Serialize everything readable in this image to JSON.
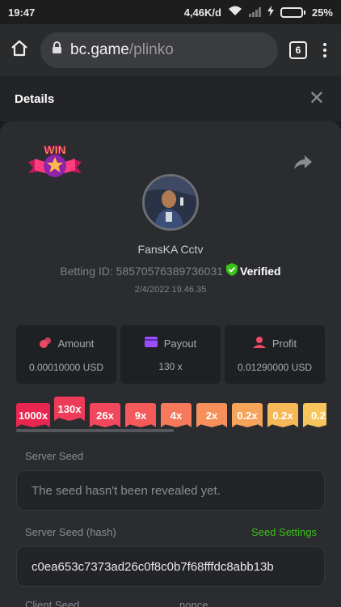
{
  "status_bar": {
    "time": "19:47",
    "speed": "4,46K/d",
    "battery": "25%",
    "battery_level": 0.25
  },
  "browser": {
    "url_host": "bc.game",
    "url_path": "/plinko",
    "tab_count": "6"
  },
  "details": {
    "title": "Details"
  },
  "player": {
    "name": "FansKA Cctv",
    "betting_id": "Betting ID: 58570576389736031",
    "verified_label": "Verified",
    "datetime": "2/4/2022 19.46.35"
  },
  "stats": {
    "amount_label": "Amount",
    "amount_value": "0.00010000 USD",
    "payout_label": "Payout",
    "payout_value": "130 x",
    "profit_label": "Profit",
    "profit_value": "0.01290000 USD"
  },
  "multipliers": [
    "1000x",
    "130x",
    "26x",
    "9x",
    "4x",
    "2x",
    "0.2x",
    "0.2x",
    "0.2"
  ],
  "multiplier_colors": [
    "#e8264f",
    "#ee3b57",
    "#f2475c",
    "#f55a5a",
    "#f7795c",
    "#f68f5a",
    "#f6a459",
    "#f7b858",
    "#f8c55c"
  ],
  "seeds": {
    "server_seed_label": "Server Seed",
    "server_seed_value": "The seed hasn't been revealed yet.",
    "server_hash_label": "Server Seed (hash)",
    "seed_settings_link": "Seed Settings",
    "server_hash_value": "c0ea653c7373ad26c0f8c0b7f68fffdc8abb13b",
    "client_seed_label": "Client Seed",
    "nonce_label": "nonce"
  },
  "colors": {
    "accent_green": "#3bc117",
    "card_bg": "#2a2c30"
  }
}
